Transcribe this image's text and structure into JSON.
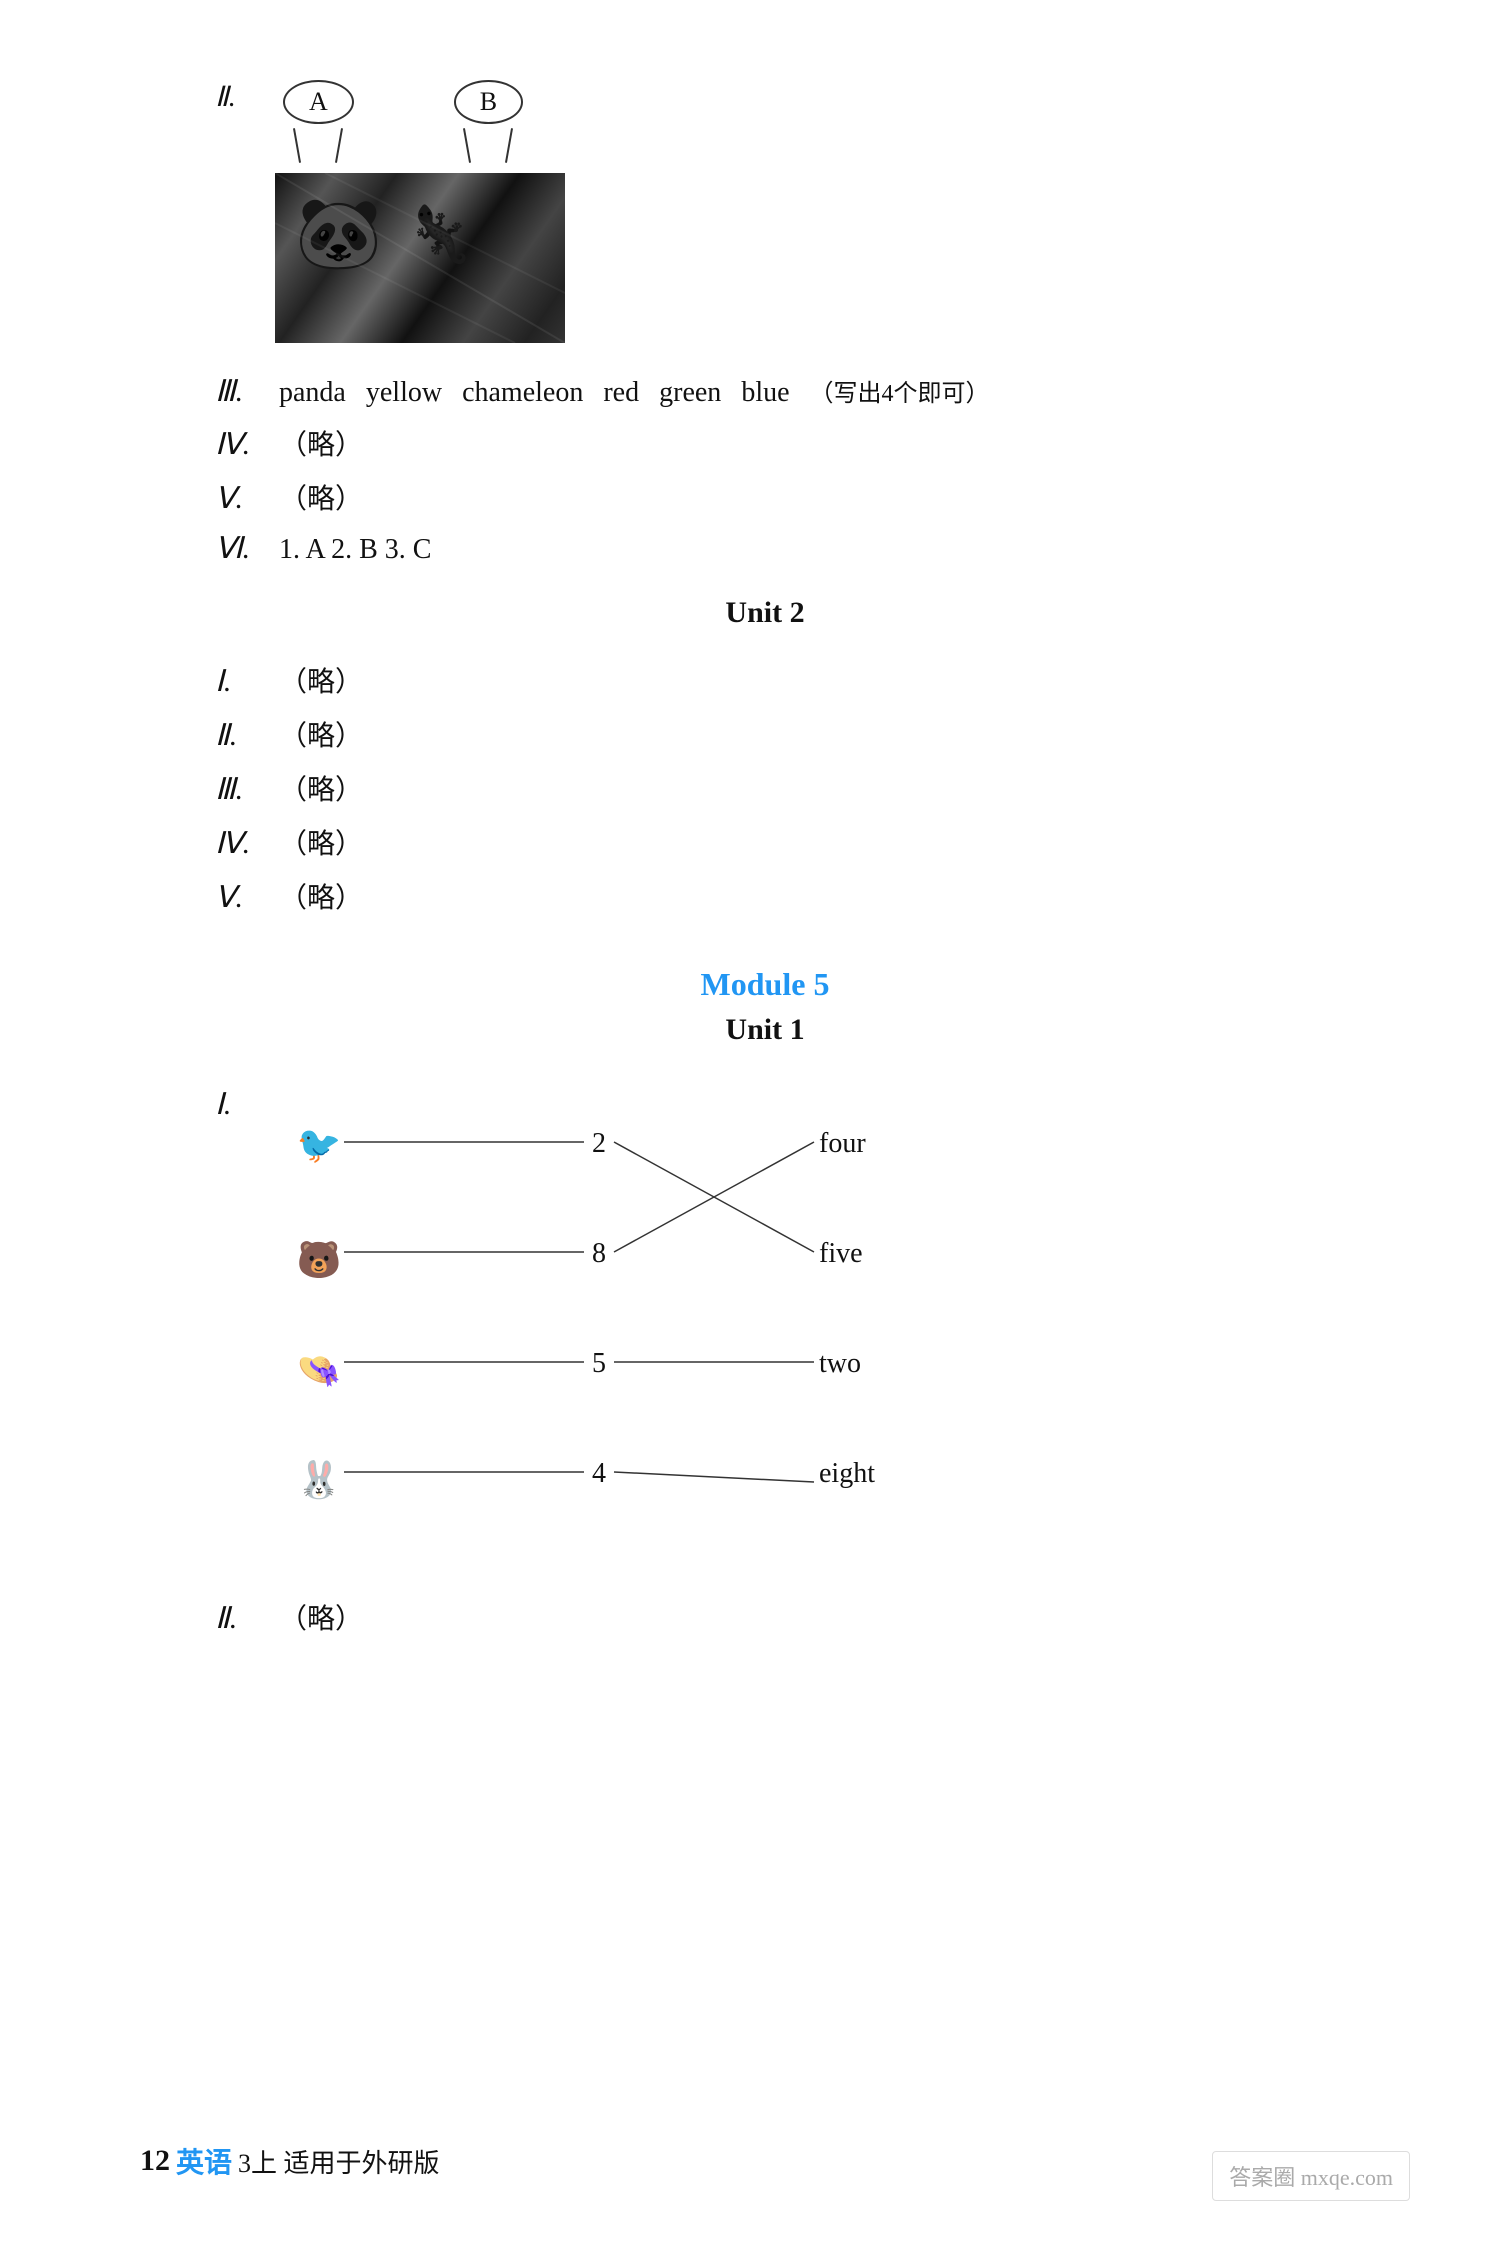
{
  "page": {
    "section_ii_label": "Ⅱ.",
    "bubble_a": "A",
    "bubble_b": "B",
    "section_iii_label": "Ⅲ.",
    "section_iii_words": [
      "panda",
      "yellow",
      "chameleon",
      "red",
      "green",
      "blue"
    ],
    "section_iii_note": "（写出4个即可）",
    "section_iv_label": "Ⅳ.",
    "section_iv_text": "（略）",
    "section_v_label": "Ⅴ.",
    "section_v_text": "（略）",
    "section_vi_label": "Ⅵ.",
    "section_vi_text": "1. A   2. B   3. C",
    "unit2_title": "Unit 2",
    "unit2_sections": [
      {
        "label": "Ⅰ.",
        "text": "（略）"
      },
      {
        "label": "Ⅱ.",
        "text": "（略）"
      },
      {
        "label": "Ⅲ.",
        "text": "（略）"
      },
      {
        "label": "Ⅳ.",
        "text": "（略）"
      },
      {
        "label": "Ⅴ.",
        "text": "（略）"
      }
    ],
    "module5_title": "Module 5",
    "unit1_title": "Unit 1",
    "matching_label": "Ⅰ.",
    "matching_left_icons": [
      "🐦",
      "🐻",
      "🎩",
      "🐰"
    ],
    "matching_numbers": [
      "2",
      "8",
      "5",
      "4"
    ],
    "matching_words": [
      "four",
      "five",
      "two",
      "eight"
    ],
    "section_ii_m5_label": "Ⅱ.",
    "section_ii_m5_text": "（略）",
    "footer_num": "12",
    "footer_text": "英语",
    "footer_sub": "3上 适用于外研版",
    "watermark": "答案圈 mxqe.com"
  }
}
